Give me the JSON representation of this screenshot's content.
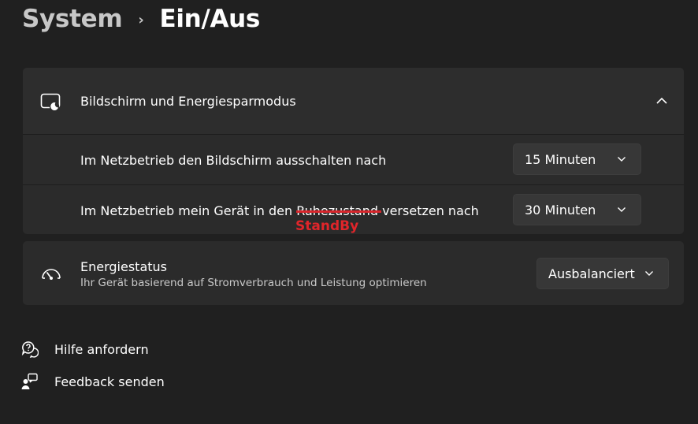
{
  "breadcrumb": {
    "parent": "System",
    "separator": "›",
    "current": "Ein/Aus"
  },
  "power_section": {
    "icon": "display-sleep-icon",
    "title": "Bildschirm und Energiesparmodus",
    "expanded_icon": "chevron-up-icon",
    "settings": [
      {
        "label": "Im Netzbetrieb den Bildschirm ausschalten nach",
        "value": "15 Minuten"
      },
      {
        "label_before": "Im Netzbetrieb mein Gerät in den ",
        "label_struck": "Ruhezustand",
        "label_after": " versetzen nach",
        "annotation": "StandBy",
        "value": "30 Minuten"
      }
    ]
  },
  "energy_section": {
    "icon": "gauge-icon",
    "title": "Energiestatus",
    "description": "Ihr Gerät basierend auf Stromverbrauch und Leistung optimieren",
    "value": "Ausbalanciert"
  },
  "links": [
    {
      "icon": "help-chat-icon",
      "label": "Hilfe anfordern"
    },
    {
      "icon": "feedback-icon",
      "label": "Feedback senden"
    }
  ],
  "colors": {
    "background": "#202020",
    "card": "#2b2b2b",
    "annotation": "#e0252a"
  }
}
